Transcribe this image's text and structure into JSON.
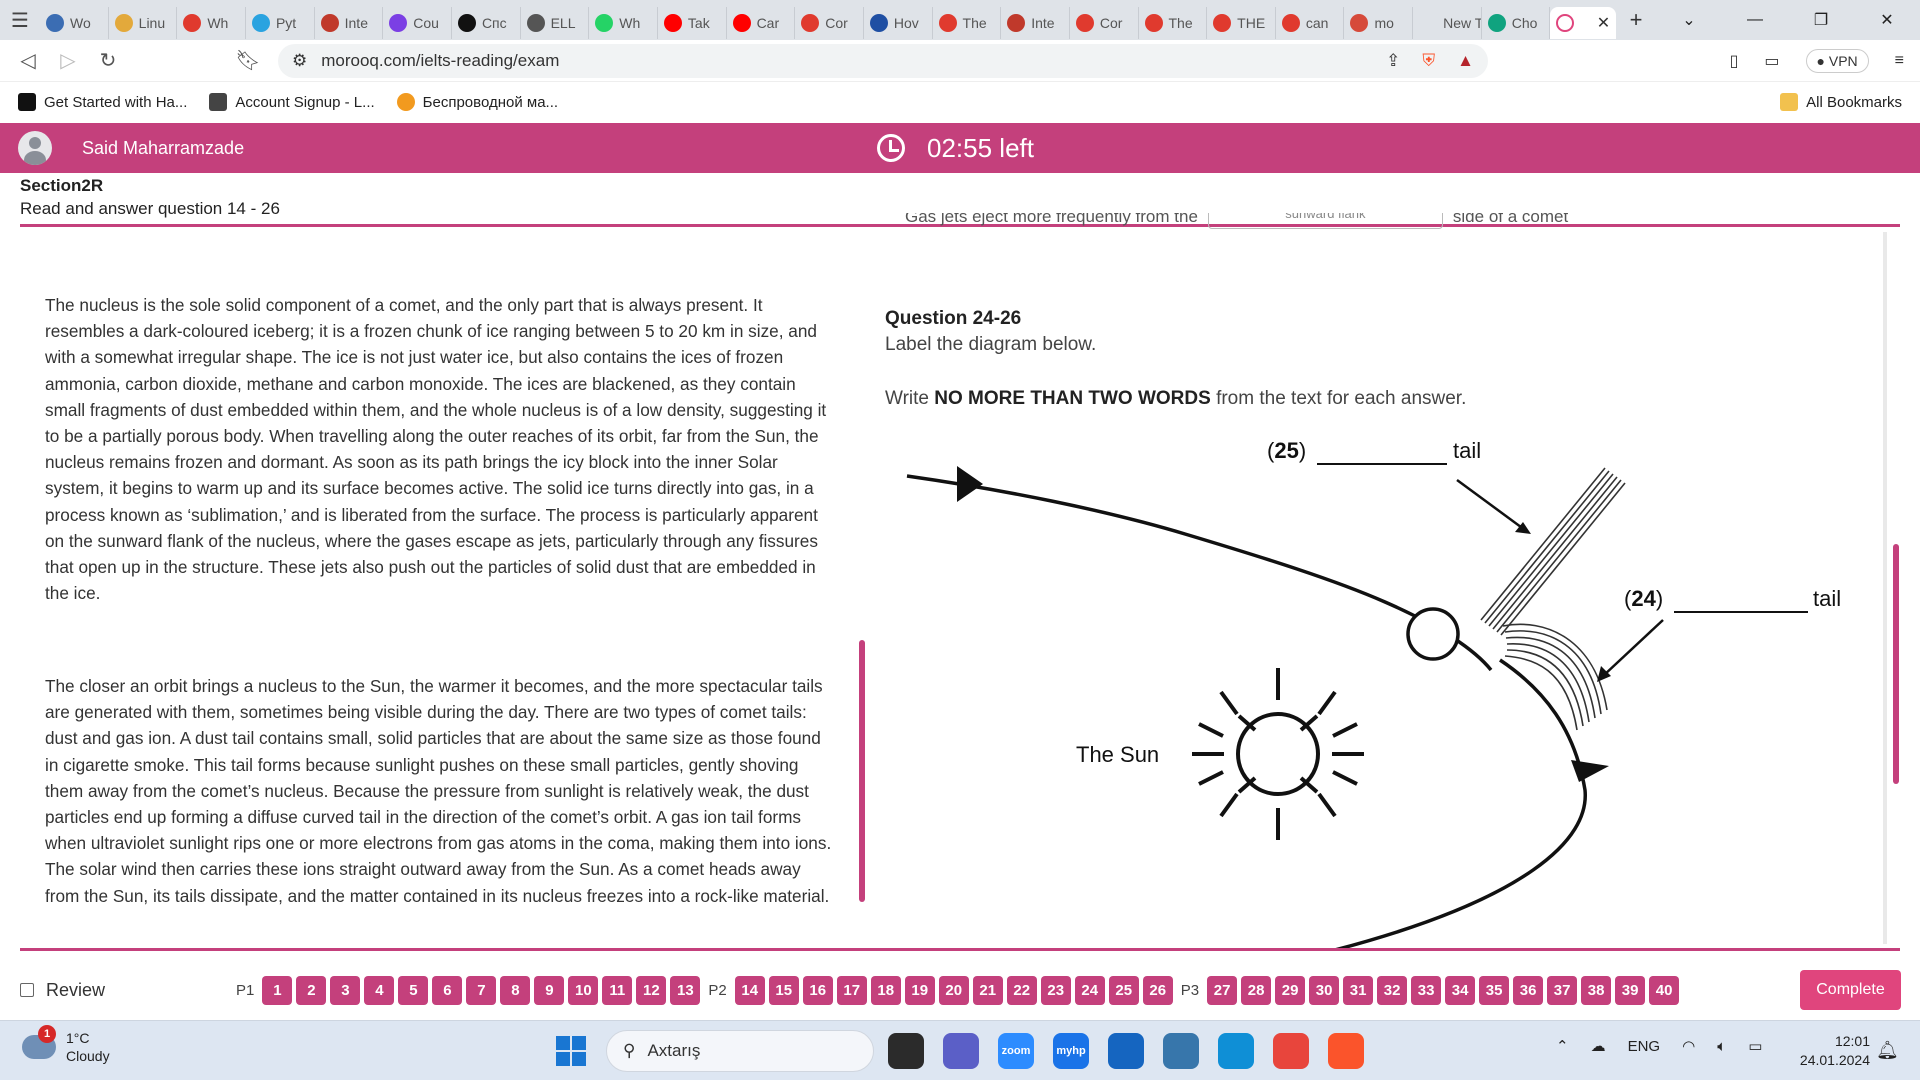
{
  "browser": {
    "tabs": [
      {
        "label": "Wo",
        "color": "#3b6db3"
      },
      {
        "label": "Linu",
        "color": "#e3a93b"
      },
      {
        "label": "Wh",
        "color": "#e03a2e"
      },
      {
        "label": "Pyt",
        "color": "#2aa3e0"
      },
      {
        "label": "Inte",
        "color": "#c0392b"
      },
      {
        "label": "Cou",
        "color": "#7b3fe4"
      },
      {
        "label": "Спс",
        "color": "#111111"
      },
      {
        "label": "ELL",
        "color": "#555555"
      },
      {
        "label": "Wh",
        "color": "#25d366"
      },
      {
        "label": "Tak",
        "color": "#ff0000"
      },
      {
        "label": "Car",
        "color": "#ff0000"
      },
      {
        "label": "Cor",
        "color": "#e03a2e"
      },
      {
        "label": "Hov",
        "color": "#1f4fa3"
      },
      {
        "label": "The",
        "color": "#e03a2e"
      },
      {
        "label": "Inte",
        "color": "#c0392b"
      },
      {
        "label": "Cor",
        "color": "#e03a2e"
      },
      {
        "label": "The",
        "color": "#e03a2e"
      },
      {
        "label": "THE",
        "color": "#e03a2e"
      },
      {
        "label": "can",
        "color": "#e03a2e"
      },
      {
        "label": "mo",
        "color": "#d64a3a"
      },
      {
        "label": "New Tab",
        "color": "#dfe3e8"
      },
      {
        "label": "Cho",
        "color": "#10a37f"
      }
    ],
    "new_tab_symbol": "+",
    "url": "morooq.com/ielts-reading/exam",
    "vpn_label": "VPN",
    "bookmarks": [
      {
        "label": "Get Started with Ha...",
        "color": "#111111"
      },
      {
        "label": "Account Signup - L...",
        "color": "#444444"
      },
      {
        "label": "Беспроводной ма...",
        "color": "#f29a1f"
      }
    ],
    "all_bookmarks": "All Bookmarks"
  },
  "exam": {
    "user_name": "Said Maharramzade",
    "timer": "02:55 left",
    "section_title": "Section2R",
    "section_sub": "Read and answer question 14 - 26",
    "cut_prefix": "Gas jets eject more frequently from the",
    "cut_box": "sunward flank",
    "cut_suffix": "side of a comet",
    "passage": [
      "The nucleus is the sole solid component of a comet, and the only part that is always present. It resembles a dark-coloured iceberg; it is a frozen chunk of ice ranging between 5 to 20 km in size, and with a somewhat irregular shape. The ice is not just water ice, but also contains the ices of frozen ammonia, carbon dioxide, methane and carbon monoxide. The ices are blackened, as they contain small fragments of dust embedded within them, and the whole nucleus is of a low density, suggesting it to be a partially porous body. When travelling along the outer reaches of its orbit, far from the Sun, the nucleus remains frozen and dormant. As soon as its path brings the icy block into the inner Solar system, it begins to warm up and its surface becomes active. The solid ice turns directly into gas, in a process known as ‘sublimation,’ and is liberated from the surface. The process is particularly apparent on the sunward flank of the nucleus, where the gases escape as jets, particularly through any fissures that open up in the structure. These jets also push out the particles of solid dust that are embedded in the ice.",
      "The closer an orbit brings a nucleus to the Sun, the warmer it becomes, and the more spectacular tails are generated with them, sometimes being visible during the day. There are two types of comet tails: dust and gas ion. A dust tail contains small, solid particles that are about the same size as those found in cigarette smoke. This tail forms because sunlight pushes on these small particles, gently shoving them away from the comet’s nucleus. Because the pressure from sunlight is relatively weak, the dust particles end up forming a diffuse curved tail in the direction of the comet’s orbit. A gas ion tail forms when ultraviolet sunlight rips one or more electrons from gas atoms in the coma, making them into ions. The solar wind then carries these ions straight outward away from the Sun. As a comet heads away from the Sun, its tails dissipate, and the matter contained in its nucleus freezes into a rock-like material."
    ],
    "question_title": "Question 24-26",
    "question_sub": "Label the diagram below.",
    "instr_pre": "Write ",
    "instr_bold": "NO MORE THAN TWO WORDS",
    "instr_post": " from the text for each answer.",
    "diagram": {
      "q25": "25",
      "q24": "24",
      "tail": "tail",
      "sun_label": "The Sun",
      "blank": "__________"
    },
    "review_label": "Review",
    "parts": [
      {
        "label": "P1",
        "questions": [
          "1",
          "2",
          "3",
          "4",
          "5",
          "6",
          "7",
          "8",
          "9",
          "10",
          "11",
          "12",
          "13"
        ]
      },
      {
        "label": "P2",
        "questions": [
          "14",
          "15",
          "16",
          "17",
          "18",
          "19",
          "20",
          "21",
          "22",
          "23",
          "24",
          "25",
          "26"
        ]
      },
      {
        "label": "P3",
        "questions": [
          "27",
          "28",
          "29",
          "30",
          "31",
          "32",
          "33",
          "34",
          "35",
          "36",
          "37",
          "38",
          "39",
          "40"
        ]
      }
    ],
    "complete_label": "Complete",
    "accent": "#c4407c"
  },
  "taskbar": {
    "weather_badge": "1",
    "temp": "1°C",
    "condition": "Cloudy",
    "search_placeholder": "Axtarış",
    "apps": [
      {
        "name": "file-explorer",
        "color": "#2b2b2b",
        "label": ""
      },
      {
        "name": "teams",
        "color": "#5b5fc7",
        "label": ""
      },
      {
        "name": "zoom",
        "color": "#2d8cff",
        "label": "zoom"
      },
      {
        "name": "myhp",
        "color": "#1a73e8",
        "label": "myhp"
      },
      {
        "name": "store",
        "color": "#1565c0",
        "label": ""
      },
      {
        "name": "python",
        "color": "#3776ab",
        "label": ""
      },
      {
        "name": "edge",
        "color": "#0f8fd6",
        "label": ""
      },
      {
        "name": "chrome",
        "color": "#e8453c",
        "label": ""
      },
      {
        "name": "brave",
        "color": "#fb542b",
        "label": ""
      }
    ],
    "lang": "ENG",
    "time": "12:01",
    "date": "24.01.2024"
  }
}
